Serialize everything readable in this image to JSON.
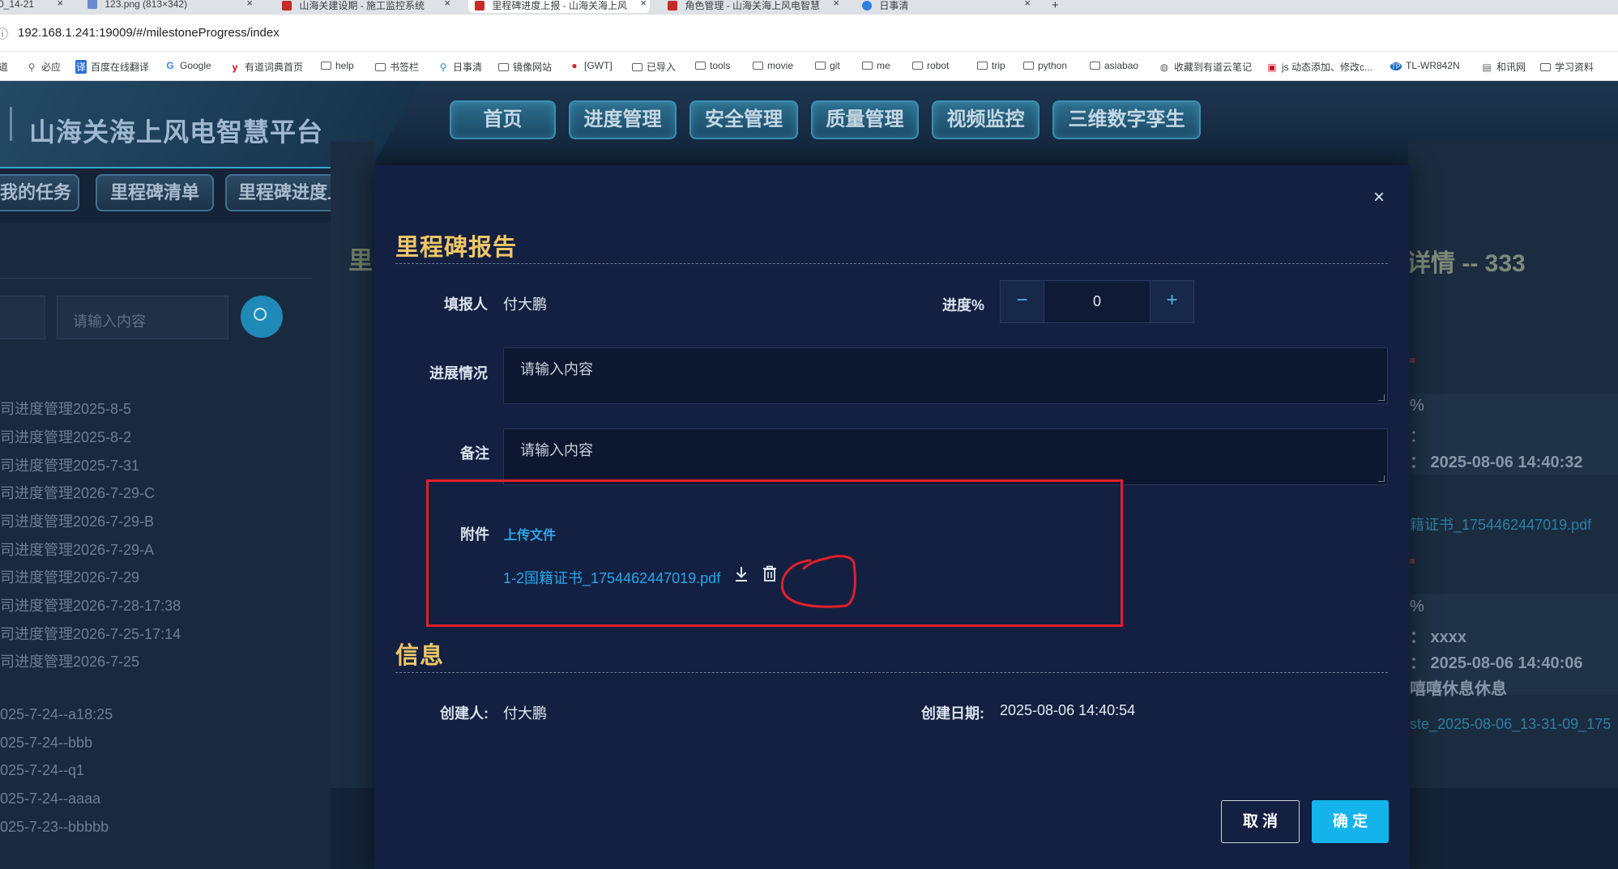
{
  "browser": {
    "tabs": [
      {
        "title": "0_14-21",
        "active": false
      },
      {
        "title": "123.png (813×342)",
        "active": false
      },
      {
        "title": "山海关建设期 - 施工监控系统",
        "active": false
      },
      {
        "title": "里程碑进度上报 - 山海关海上风",
        "active": true
      },
      {
        "title": "角色管理 - 山海关海上风电智慧",
        "active": false
      },
      {
        "title": "日事清",
        "active": false
      }
    ],
    "new_tab": "+",
    "close_glyph": "×",
    "url": "192.168.1.241:19009/#/milestoneProgress/index",
    "bookmarks": [
      {
        "label": "道",
        "icon": "none"
      },
      {
        "label": "必应",
        "icon": "search"
      },
      {
        "label": "百度在线翻译",
        "icon": "translate"
      },
      {
        "label": "Google",
        "icon": "google"
      },
      {
        "label": "有道词典首页",
        "icon": "youdao"
      },
      {
        "label": "help",
        "icon": "folder"
      },
      {
        "label": "书签栏",
        "icon": "folder"
      },
      {
        "label": "日事清",
        "icon": "pin"
      },
      {
        "label": "镜像网站",
        "icon": "folder"
      },
      {
        "label": "[GWT]",
        "icon": "gwt"
      },
      {
        "label": "已导入",
        "icon": "folder"
      },
      {
        "label": "tools",
        "icon": "folder"
      },
      {
        "label": "movie",
        "icon": "folder"
      },
      {
        "label": "git",
        "icon": "folder"
      },
      {
        "label": "me",
        "icon": "folder"
      },
      {
        "label": "robot",
        "icon": "folder"
      },
      {
        "label": "trip",
        "icon": "folder"
      },
      {
        "label": "python",
        "icon": "folder"
      },
      {
        "label": "asiabao",
        "icon": "folder"
      },
      {
        "label": "收藏到有道云笔记",
        "icon": "globe"
      },
      {
        "label": "js 动态添加、修改c...",
        "icon": "site"
      },
      {
        "label": "TL-WR842N",
        "icon": "tp"
      },
      {
        "label": "和讯网",
        "icon": "site"
      },
      {
        "label": "学习资料",
        "icon": "folder"
      }
    ]
  },
  "app": {
    "title": "山海关海上风电智慧平台",
    "nav": [
      "首页",
      "进度管理",
      "安全管理",
      "质量管理",
      "视频监控",
      "三维数字孪生"
    ],
    "subnav": [
      "我的任务",
      "里程碑清单",
      "里程碑进度上报"
    ],
    "left": {
      "search_placeholder": "请输入内容",
      "items": [
        "司进度管理2025-8-5",
        "司进度管理2025-8-2",
        "司进度管理2025-7-31",
        "司进度管理2026-7-29-C",
        "司进度管理2026-7-29-B",
        "司进度管理2026-7-29-A",
        "司进度管理2026-7-29",
        "司进度管理2026-7-28-17:38",
        "司进度管理2026-7-25-17:14",
        "司进度管理2026-7-25",
        "025-7-24--a18:25",
        "025-7-24--bbb",
        "025-7-24--q1",
        "025-7-24--aaaa",
        "025-7-23--bbbbb"
      ],
      "mid_char": "里"
    },
    "right": {
      "title": "详情 -- 333",
      "texts": [
        "%",
        "：",
        "：  2025-08-06 14:40:32",
        "%",
        "：  xxxx",
        "：  2025-08-06 14:40:06",
        "嘻嘻休息休息"
      ],
      "links": [
        "籍证书_1754462447019.pdf",
        "ste_2025-08-06_13-31-09_175"
      ]
    }
  },
  "modal": {
    "close_glyph": "×",
    "section1_title": "里程碑报告",
    "reporter_label": "填报人",
    "reporter_value": "付大鹏",
    "progress_label": "进度%",
    "progress_value": "0",
    "minus_glyph": "−",
    "plus_glyph": "+",
    "status_label": "进展情况",
    "status_placeholder": "请输入内容",
    "remark_label": "备注",
    "remark_placeholder": "请输入内容",
    "attachment_label": "附件",
    "upload_label": "上传文件",
    "file_name": "1-2国籍证书_1754462447019.pdf",
    "section2_title": "信息",
    "creator_label": "创建人:",
    "creator_value": "付大鹏",
    "created_date_label": "创建日期:",
    "created_date_value": "2025-08-06 14:40:54",
    "cancel_label": "取 消",
    "ok_label": "确 定"
  },
  "colors": {
    "accent": "#14b3ec",
    "section_title": "#f0c766",
    "annotation_red": "#e0202b",
    "modal_bg": "#142041"
  }
}
